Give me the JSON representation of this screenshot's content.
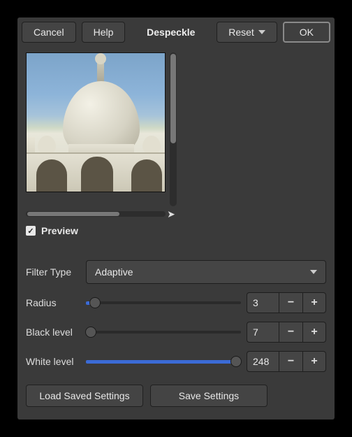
{
  "header": {
    "cancel": "Cancel",
    "help": "Help",
    "title": "Despeckle",
    "reset": "Reset",
    "ok": "OK"
  },
  "preview": {
    "label": "Preview",
    "checked": true
  },
  "filter": {
    "label": "Filter Type",
    "value": "Adaptive"
  },
  "sliders": {
    "radius": {
      "label": "Radius",
      "value": "3",
      "min": 1,
      "max": 20,
      "fill_pct": 6,
      "thumb_pct": 6
    },
    "black": {
      "label": "Black level",
      "value": "7",
      "min": -1,
      "max": 255,
      "fill_pct": 3,
      "thumb_pct": 3
    },
    "white": {
      "label": "White level",
      "value": "248",
      "min": 0,
      "max": 256,
      "fill_pct": 97,
      "thumb_pct": 97
    }
  },
  "footer": {
    "load": "Load Saved Settings",
    "save": "Save Settings"
  }
}
